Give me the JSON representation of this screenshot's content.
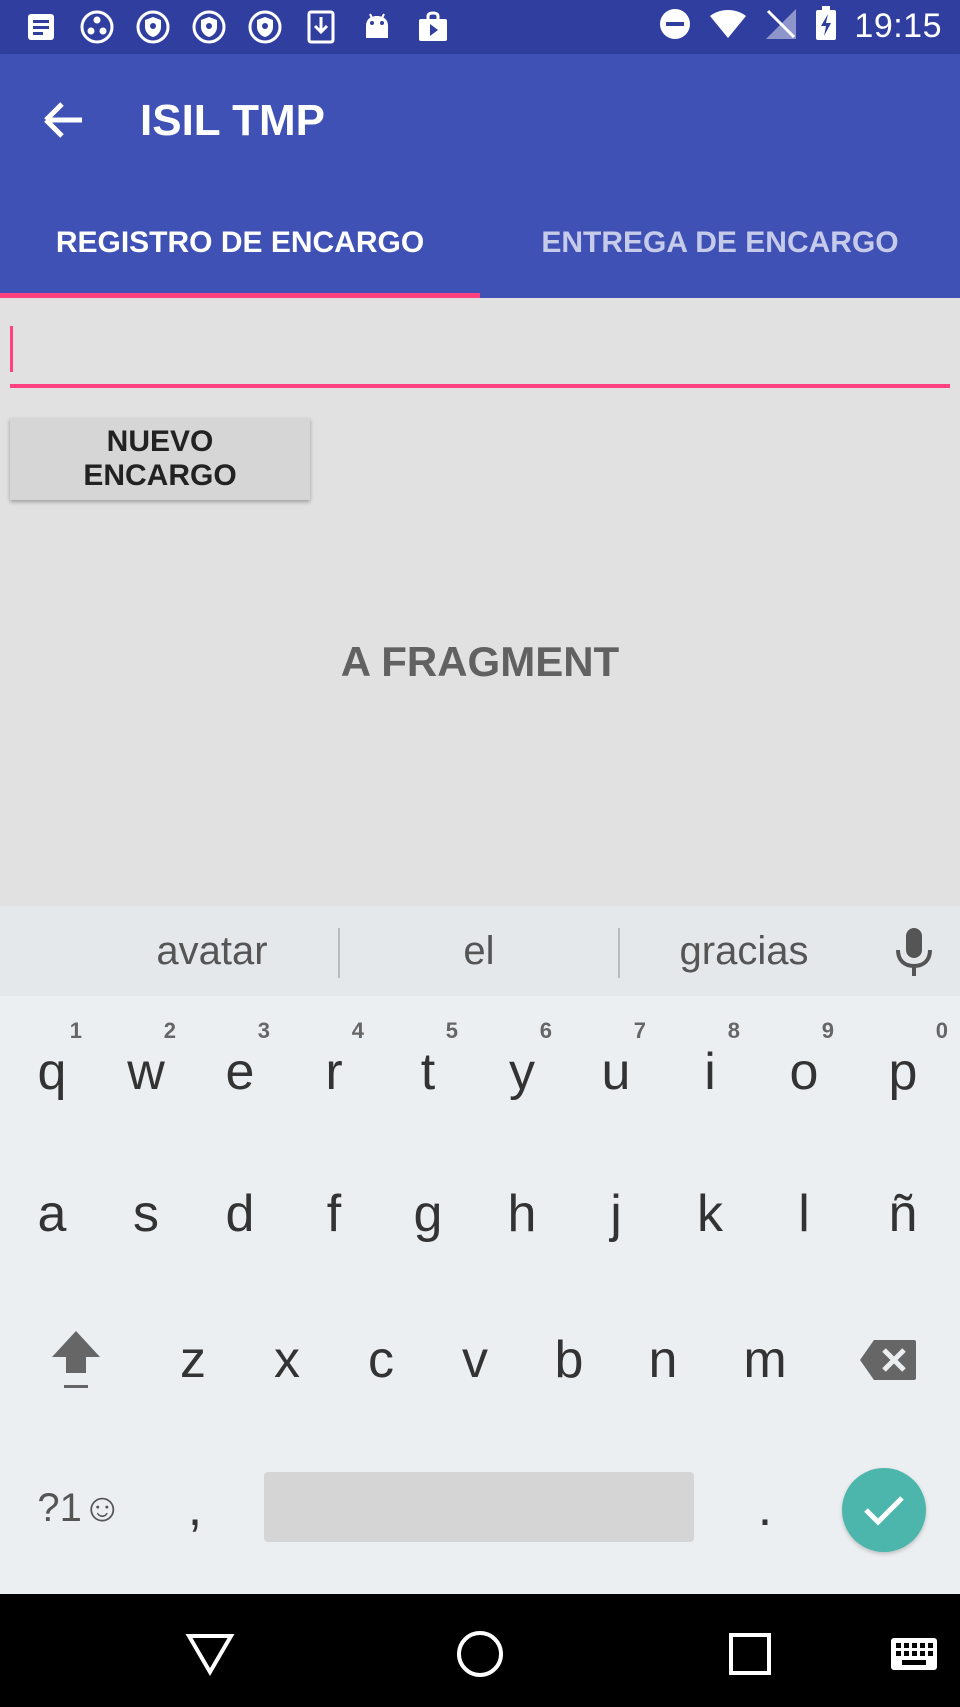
{
  "status_bar": {
    "time": "19:15",
    "left_icons": [
      "notes-icon",
      "network-icon",
      "vpn-key-icon",
      "vpn-key-icon",
      "vpn-key-icon",
      "download-icon",
      "android-icon",
      "play-store-icon"
    ],
    "right_icons": [
      "do-not-disturb-icon",
      "wifi-icon",
      "no-signal-icon",
      "battery-charging-icon"
    ]
  },
  "app_bar": {
    "title": "ISIL TMP",
    "back_icon": "arrow-back-icon",
    "color": "#3f51b5",
    "status_color": "#303f9f"
  },
  "tabs": [
    {
      "label": "REGISTRO DE ENCARGO",
      "active": true
    },
    {
      "label": "ENTREGA DE ENCARGO",
      "active": false
    }
  ],
  "accent_color": "#ff4081",
  "content": {
    "input_value": "",
    "new_button_label": "NUEVO ENCARGO",
    "fragment_label": "A FRAGMENT"
  },
  "keyboard": {
    "suggestions": [
      "avatar",
      "el",
      "gracias"
    ],
    "row1": [
      {
        "key": "q",
        "hint": "1"
      },
      {
        "key": "w",
        "hint": "2"
      },
      {
        "key": "e",
        "hint": "3"
      },
      {
        "key": "r",
        "hint": "4"
      },
      {
        "key": "t",
        "hint": "5"
      },
      {
        "key": "y",
        "hint": "6"
      },
      {
        "key": "u",
        "hint": "7"
      },
      {
        "key": "i",
        "hint": "8"
      },
      {
        "key": "o",
        "hint": "9"
      },
      {
        "key": "p",
        "hint": "0"
      }
    ],
    "row2": [
      "a",
      "s",
      "d",
      "f",
      "g",
      "h",
      "j",
      "k",
      "l",
      "ñ"
    ],
    "row3": [
      "z",
      "x",
      "c",
      "v",
      "b",
      "n",
      "m"
    ],
    "symbols_label": "?1☺",
    "comma": ",",
    "period": ".",
    "enter_color": "#4db6ac"
  },
  "nav_bar": {
    "icons": [
      "back-triangle-icon",
      "home-circle-icon",
      "recents-square-icon",
      "keyboard-icon"
    ]
  }
}
